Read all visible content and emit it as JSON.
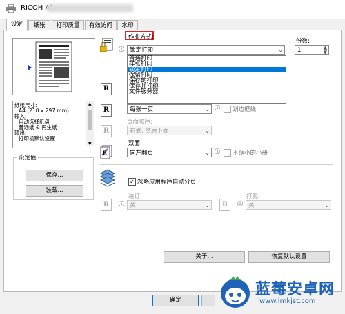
{
  "window": {
    "title": "RICOH Aſ"
  },
  "tabs": [
    {
      "label": "设定"
    },
    {
      "label": "纸张"
    },
    {
      "label": "打印质量"
    },
    {
      "label": "有效访问"
    },
    {
      "label": "水印"
    }
  ],
  "left": {
    "list_lines": [
      "纸张尺寸:",
      "A4 (210 x 297 mm)",
      "输入:",
      "自动选择纸盘",
      "普通纸 & 再生纸",
      "输出:",
      "打印机默认设置"
    ],
    "settings_group_label": "设定值",
    "save_button": "保存...",
    "load_button": "装载..."
  },
  "job": {
    "label": "作业方式:",
    "value": "锁定打印",
    "options": [
      "普通打印",
      "样张打印",
      "锁定打印",
      "保留打印",
      "保存的打印",
      "保存并打印",
      "文件服务器"
    ],
    "selected": "锁定打印"
  },
  "copies": {
    "label": "份数:",
    "value": "1"
  },
  "pages_per_sheet": {
    "value": "每张一页",
    "border_label": "划边框线"
  },
  "page_order": {
    "label": "页面顺序:",
    "value": "右到, 然后下面"
  },
  "duplex": {
    "label": "双面:",
    "value": "向左翻页",
    "reduce_label": "不缩小的小册"
  },
  "collate": {
    "label": "忽略应用程序自动分页"
  },
  "staple": {
    "label": "装订:",
    "value": "关"
  },
  "punch": {
    "label": "打孔:",
    "value": "关"
  },
  "buttons": {
    "about": "关于...",
    "restore": "恢复默认设置",
    "ok": "确定"
  },
  "watermark": {
    "title": "蓝莓安卓网",
    "url": "www.lmkjst.com"
  },
  "colors": {
    "accent": "#0078d7",
    "highlight_box": "#e02020",
    "watermark_blue": "#1e63b8"
  }
}
